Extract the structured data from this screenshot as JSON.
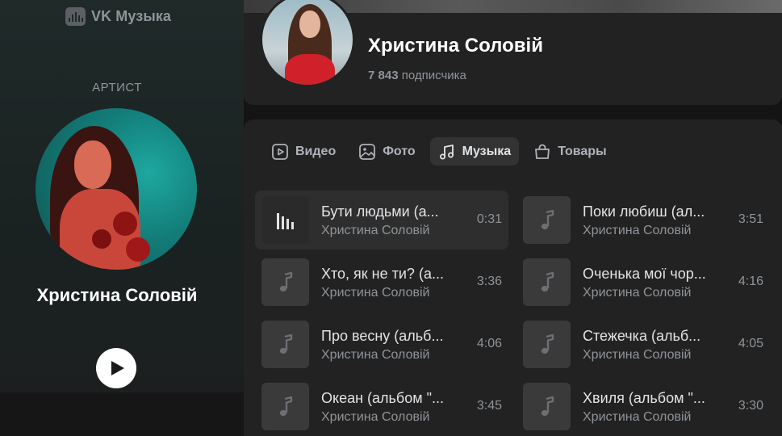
{
  "app": {
    "brand": "VK Музыка"
  },
  "sidebar": {
    "caption": "АРТИСТ",
    "artist_name": "Христина Соловій"
  },
  "profile": {
    "name": "Христина Соловій",
    "subscribers_count": "7 843",
    "subscribers_label": "подписчика"
  },
  "tabs": [
    {
      "label": "Видео",
      "icon": "video-icon",
      "active": false
    },
    {
      "label": "Фото",
      "icon": "photo-icon",
      "active": false
    },
    {
      "label": "Музыка",
      "icon": "music-note-icon",
      "active": true
    },
    {
      "label": "Товары",
      "icon": "shopping-bag-icon",
      "active": false
    }
  ],
  "tracks": [
    {
      "title": "Бути людьми (а...",
      "artist": "Христина Соловій",
      "duration": "0:31",
      "playing": true
    },
    {
      "title": "Поки любиш (ал...",
      "artist": "Христина Соловій",
      "duration": "3:51",
      "playing": false
    },
    {
      "title": "Хто, як не ти? (а...",
      "artist": "Христина Соловій",
      "duration": "3:36",
      "playing": false
    },
    {
      "title": "Оченька мої чор...",
      "artist": "Христина Соловій",
      "duration": "4:16",
      "playing": false
    },
    {
      "title": "Про весну (альб...",
      "artist": "Христина Соловій",
      "duration": "4:06",
      "playing": false
    },
    {
      "title": "Стежечка (альб...",
      "artist": "Христина Соловій",
      "duration": "4:05",
      "playing": false
    },
    {
      "title": "Океан (альбом \"...",
      "artist": "Христина Соловій",
      "duration": "3:45",
      "playing": false
    },
    {
      "title": "Хвиля (альбом \"...",
      "artist": "Христина Соловій",
      "duration": "3:30",
      "playing": false
    }
  ]
}
